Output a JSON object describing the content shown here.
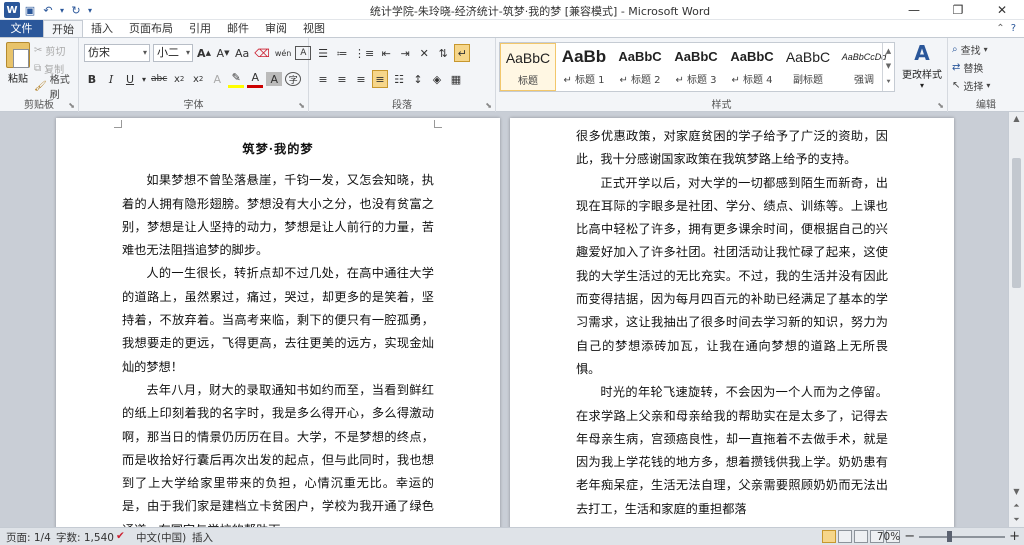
{
  "window": {
    "title": "统计学院-朱玲晓-经济统计-筑梦·我的梦 [兼容模式] - Microsoft Word",
    "app_icon": "W",
    "controls": [
      "—",
      "❐",
      "✕"
    ]
  },
  "tabs": [
    "文件",
    "开始",
    "插入",
    "页面布局",
    "引用",
    "邮件",
    "审阅",
    "视图"
  ],
  "active_tab": "开始",
  "ribbon": {
    "clipboard": {
      "label": "剪贴板",
      "paste": "粘贴",
      "cut": "剪切",
      "copy": "复制",
      "format_painter": "格式刷"
    },
    "font": {
      "label": "字体",
      "font_name": "仿宋",
      "font_size": "小二",
      "clear": "Aa",
      "phonetic": "wén",
      "font_color": "#cc0000",
      "highlight_color": "#ffff00"
    },
    "paragraph": {
      "label": "段落"
    },
    "styles": {
      "label": "样式",
      "change_styles": "更改样式",
      "items": [
        {
          "preview": "AaBbC",
          "name": "标题"
        },
        {
          "preview": "AaBb",
          "name": "↵ 标题 1"
        },
        {
          "preview": "AaBbC",
          "name": "↵ 标题 2"
        },
        {
          "preview": "AaBbC",
          "name": "↵ 标题 3"
        },
        {
          "preview": "AaBbC",
          "name": "↵ 标题 4"
        },
        {
          "preview": "AaBbC",
          "name": "副标题"
        },
        {
          "preview": "AaBbCcDd",
          "name": "强调"
        }
      ]
    },
    "editing": {
      "label": "编辑",
      "find": "查找",
      "replace": "替换",
      "select": "选择"
    }
  },
  "document": {
    "page1": {
      "title": "筑梦·我的梦",
      "paragraphs": [
        "如果梦想不曾坠落悬崖，千钧一发，又怎会知晓，执着的人拥有隐形翅膀。梦想没有大小之分，也没有贫富之别，梦想是让人坚持的动力，梦想是让人前行的力量，苦难也无法阻挡追梦的脚步。",
        "人的一生很长，转折点却不过几处，在高中通往大学的道路上，虽然累过，痛过，哭过，却更多的是笑着，坚持着，不放弃着。当高考来临，剩下的便只有一腔孤勇，我想要走的更远，飞得更高，去往更美的远方，实现金灿灿的梦想！",
        "去年八月，财大的录取通知书如约而至，当看到鲜红的纸上印刻着我的名字时，我是多么得开心，多么得激动啊，那当日的情景仍历历在目。大学，不是梦想的终点，而是收拾好行囊后再次出发的起点，但与此同时，我也想到了上大学给家里带来的负担，心情沉重无比。幸运的是，由于我们家是建档立卡贫困户，学校为我开通了绿色通道，在国家与学校的帮助下"
      ]
    },
    "page2": {
      "paragraphs": [
        "很多优惠政策，对家庭贫困的学子给予了广泛的资助，因此，我十分感谢国家政策在我筑梦路上给予的支持。",
        "正式开学以后，对大学的一切都感到陌生而新奇，出现在耳际的字眼多是社团、学分、绩点、训练等。上课也比高中轻松了许多，拥有更多课余时间，便根据自己的兴趣爱好加入了许多社团。社团活动让我忙碌了起来，这使我的大学生活过的无比充实。不过，我的生活并没有因此而变得拮据，因为每月四百元的补助已经满足了基本的学习需求，这让我抽出了很多时间去学习新的知识，努力为自己的梦想添砖加瓦，让我在通向梦想的道路上无所畏惧。",
        "时光的年轮飞速旋转，不会因为一个人而为之停留。在求学路上父亲和母亲给我的帮助实在是太多了，记得去年母亲生病，宫颈癌良性，却一直拖着不去做手术，就是因为我上学花钱的地方多，想着攒钱供我上学。奶奶患有老年痴呆症，生活无法自理，父亲需要照顾奶奶而无法出去打工，生活和家庭的重担都落"
      ]
    }
  },
  "status": {
    "page": "页面: 1/4",
    "words": "字数: 1,540",
    "language": "中文(中国)",
    "mode": "插入",
    "zoom": "70%",
    "zoom_minus": "−",
    "zoom_plus": "+"
  }
}
